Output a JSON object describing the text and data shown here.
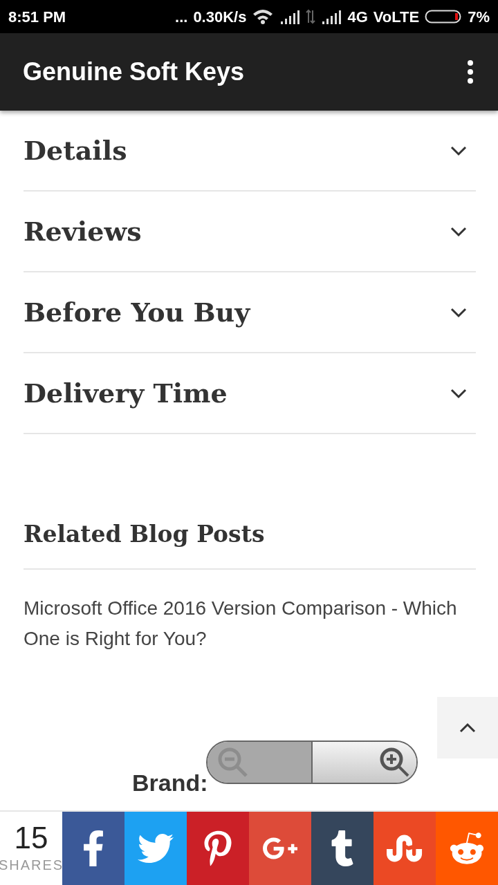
{
  "status_bar": {
    "time": "8:51 PM",
    "dots": "...",
    "speed": "0.30K/s",
    "network": "4G",
    "volte": "VoLTE",
    "battery": "7%"
  },
  "app_bar": {
    "title": "Genuine Soft Keys"
  },
  "accordion": [
    {
      "label": "Details",
      "expanded": false
    },
    {
      "label": "Reviews",
      "expanded": false
    },
    {
      "label": "Before You Buy",
      "expanded": false
    },
    {
      "label": "Delivery Time",
      "expanded": false
    }
  ],
  "related": {
    "heading": "Related Blog Posts",
    "posts": [
      "Microsoft Office 2016 Version Comparison - Which One is Right for You?"
    ]
  },
  "brand": "Brand:",
  "share_bar": {
    "count": "15",
    "count_label": "SHARES",
    "buttons": [
      {
        "kind": "facebook",
        "color": "#3b5998"
      },
      {
        "kind": "twitter",
        "color": "#1da1f2"
      },
      {
        "kind": "pinterest",
        "color": "#cb2027"
      },
      {
        "kind": "googleplus",
        "color": "#dd4b39"
      },
      {
        "kind": "tumblr",
        "color": "#35465c"
      },
      {
        "kind": "stumbleupon",
        "color": "#eb4924"
      },
      {
        "kind": "reddit",
        "color": "#ff5700"
      }
    ]
  }
}
